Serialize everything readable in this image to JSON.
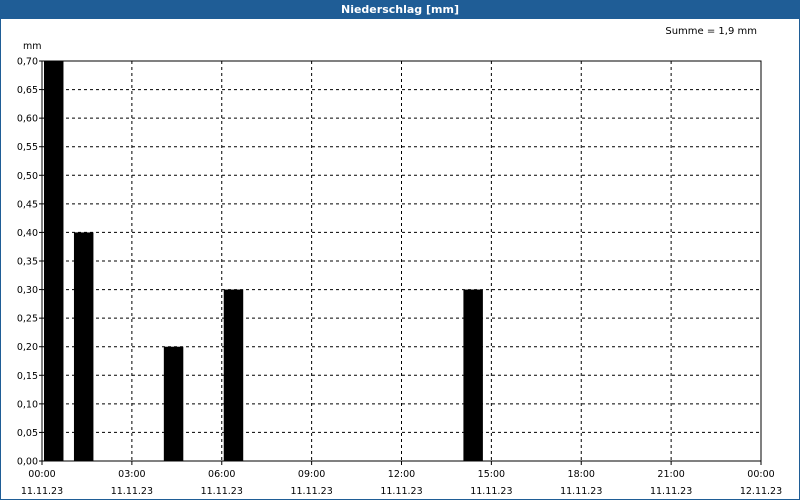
{
  "window": {
    "title": "Niederschlag [mm]",
    "summary": "Summe = 1,9 mm"
  },
  "colors": {
    "titlebar": "#1f5d96",
    "bars": "#000000",
    "grid": "#000000"
  },
  "chart_data": {
    "type": "bar",
    "title": "Niederschlag [mm]",
    "ylabel": "mm",
    "ylim": [
      0,
      0.7
    ],
    "yticks": [
      "0,00",
      "0,05",
      "0,10",
      "0,15",
      "0,20",
      "0,25",
      "0,30",
      "0,35",
      "0,40",
      "0,45",
      "0,50",
      "0,55",
      "0,60",
      "0,65",
      "0,70"
    ],
    "xlim_hours": [
      0,
      24
    ],
    "xticks": [
      {
        "time": "00:00",
        "date": "11.11.23"
      },
      {
        "time": "03:00",
        "date": "11.11.23"
      },
      {
        "time": "06:00",
        "date": "11.11.23"
      },
      {
        "time": "09:00",
        "date": "11.11.23"
      },
      {
        "time": "12:00",
        "date": "11.11.23"
      },
      {
        "time": "15:00",
        "date": "11.11.23"
      },
      {
        "time": "18:00",
        "date": "11.11.23"
      },
      {
        "time": "21:00",
        "date": "11.11.23"
      },
      {
        "time": "00:00",
        "date": "12.11.23"
      }
    ],
    "bars": [
      {
        "start": "00:00",
        "end": "00:45",
        "value": 0.7
      },
      {
        "start": "01:00",
        "end": "01:45",
        "value": 0.4
      },
      {
        "start": "04:00",
        "end": "04:45",
        "value": 0.2
      },
      {
        "start": "06:00",
        "end": "06:45",
        "value": 0.3
      },
      {
        "start": "14:00",
        "end": "14:45",
        "value": 0.3
      }
    ],
    "grid": true,
    "grid_style": "dashed",
    "summary": "Summe = 1,9 mm"
  }
}
